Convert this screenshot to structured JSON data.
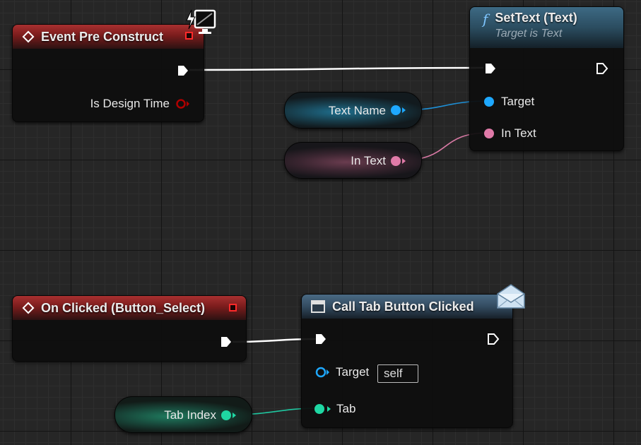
{
  "nodes": {
    "event_pre_construct": {
      "title": "Event Pre Construct",
      "outputs": {
        "is_design_time": "Is Design Time"
      }
    },
    "set_text": {
      "title": "SetText (Text)",
      "subtitle": "Target is Text",
      "function_symbol": "f",
      "inputs": {
        "target": "Target",
        "in_text": "In Text"
      }
    },
    "text_name_var": {
      "label": "Text Name"
    },
    "in_text_var": {
      "label": "In Text"
    },
    "on_clicked": {
      "title": "On Clicked (Button_Select)"
    },
    "call_tab_button_clicked": {
      "title": "Call Tab Button Clicked",
      "inputs": {
        "target": "Target",
        "target_value": "self",
        "tab": "Tab"
      }
    },
    "tab_index_var": {
      "label": "Tab Index"
    }
  },
  "icons": {
    "pre_construct_badge": "monitor-lightning-icon",
    "call_badge": "envelope-icon",
    "function": "function-icon",
    "event": "event-diamond-icon"
  },
  "colors": {
    "event_header": "#a83030",
    "function_header": "#3d6a84",
    "call_header": "#4a6a84",
    "text_pin": "#1ea8ff",
    "in_text_pin": "#e07aa8",
    "bool_pin": "#b00000",
    "int_pin": "#1fd7a3",
    "object_pin": "#1ea8ff",
    "exec_wire": "#ffffff"
  }
}
